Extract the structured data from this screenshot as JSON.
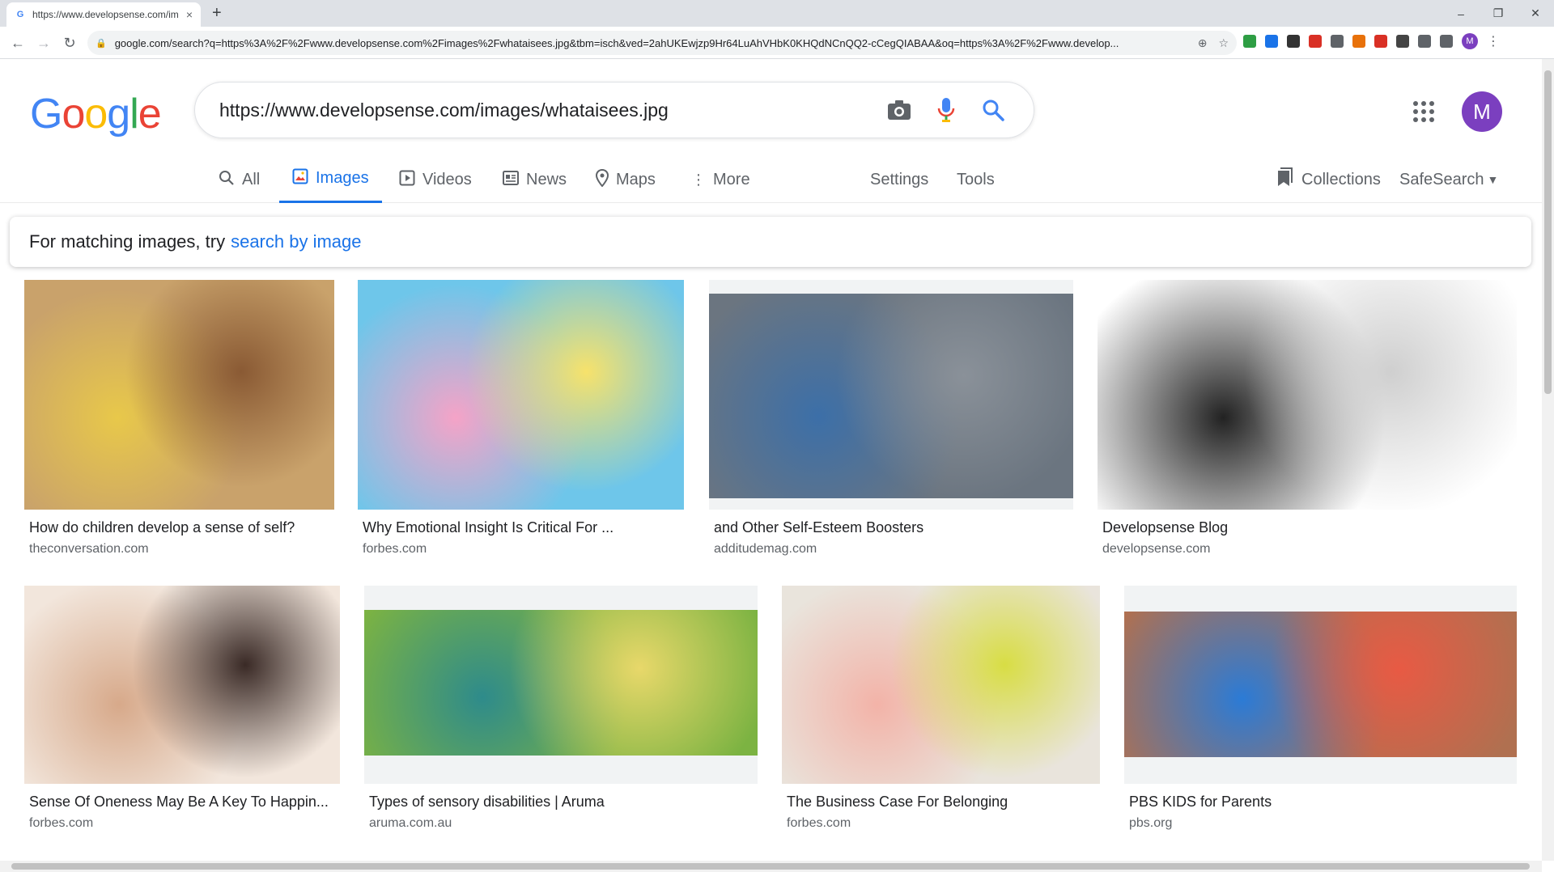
{
  "browser": {
    "tab_title": "https://www.developsense.com/im",
    "tab_favicon": "G",
    "tab_close": "×",
    "new_tab": "+",
    "window_controls": [
      "–",
      "❐",
      "✕"
    ],
    "url": "google.com/search?q=https%3A%2F%2Fwww.developsense.com%2Fimages%2Fwhataisees.jpg&tbm=isch&ved=2ahUKEwjzp9Hr64LuAhVHbK0KHQdNCnQQ2-cCegQIABAA&oq=https%3A%2F%2Fwww.develop...",
    "profile_initial": "M",
    "extension_colors": [
      "#2e9e44",
      "#1a73e8",
      "#333333",
      "#d93025",
      "#5f6368",
      "#e8710a",
      "#d93025",
      "#444444",
      "#5f6368",
      "#5f6368"
    ]
  },
  "google": {
    "logo": [
      "G",
      "o",
      "o",
      "g",
      "l",
      "e"
    ],
    "query": "https://www.developsense.com/images/whataisees.jpg",
    "avatar_initial": "M"
  },
  "tabs": {
    "all": "All",
    "images": "Images",
    "videos": "Videos",
    "news": "News",
    "maps": "Maps",
    "more": "More",
    "settings": "Settings",
    "tools": "Tools",
    "collections": "Collections",
    "safesearch": "SafeSearch"
  },
  "hint": {
    "prefix": "For matching images, try",
    "link": "search by image"
  },
  "results": [
    {
      "title": "How do children develop a sense of self?",
      "domain": "theconversation.com",
      "colors": [
        "#c9a26b",
        "#e8c84a",
        "#8a5a34"
      ]
    },
    {
      "title": "Why Emotional Insight Is Critical For ...",
      "domain": "forbes.com",
      "colors": [
        "#6ec6ea",
        "#f5a3c7",
        "#f7e26b"
      ]
    },
    {
      "title": "and Other Self-Esteem Boosters",
      "domain": "additudemag.com",
      "colors": [
        "#6b7580",
        "#3c6fa8",
        "#8a9199"
      ]
    },
    {
      "title": "Developsense Blog",
      "domain": "developsense.com",
      "colors": [
        "#ffffff",
        "#222222",
        "#cfcfcf"
      ]
    },
    {
      "title": "Sense Of Oneness May Be A Key To Happin...",
      "domain": "forbes.com",
      "colors": [
        "#f2e6dc",
        "#d7a98a",
        "#3a2a26"
      ]
    },
    {
      "title": "Types of sensory disabilities | Aruma",
      "domain": "aruma.com.au",
      "colors": [
        "#7cb342",
        "#2e8b8b",
        "#e8d86a"
      ]
    },
    {
      "title": "The Business Case For Belonging",
      "domain": "forbes.com",
      "colors": [
        "#e9e4dc",
        "#f3b3a8",
        "#d8dd44"
      ]
    },
    {
      "title": "PBS KIDS for Parents",
      "domain": "pbs.org",
      "colors": [
        "#b07050",
        "#2b7bd6",
        "#e85a44"
      ]
    }
  ]
}
